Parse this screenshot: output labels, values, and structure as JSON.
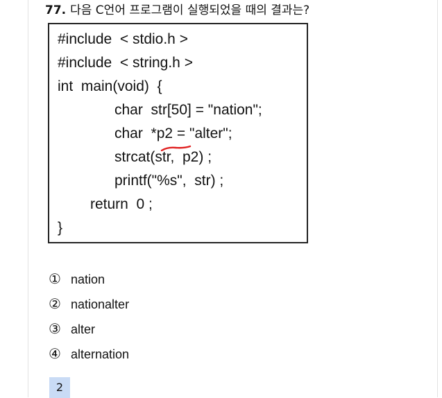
{
  "question": {
    "number": "77.",
    "text": "다음 C언어 프로그램이 실행되었을 때의 결과는?"
  },
  "code_lines": [
    "#include  < stdio.h >",
    "#include  < string.h >",
    "int  main(void)  {",
    "char  str[50] = \"nation\";",
    "char  *p2 = \"alter\";",
    "strcat(str,  p2) ;",
    "printf(\"%s\",  str) ;",
    "return  0 ;",
    "}"
  ],
  "annotation": {
    "color": "#e02020"
  },
  "options": [
    {
      "mark": "①",
      "text": "nation"
    },
    {
      "mark": "②",
      "text": "nationalter"
    },
    {
      "mark": "③",
      "text": "alter"
    },
    {
      "mark": "④",
      "text": "alternation"
    }
  ],
  "answer": "2"
}
